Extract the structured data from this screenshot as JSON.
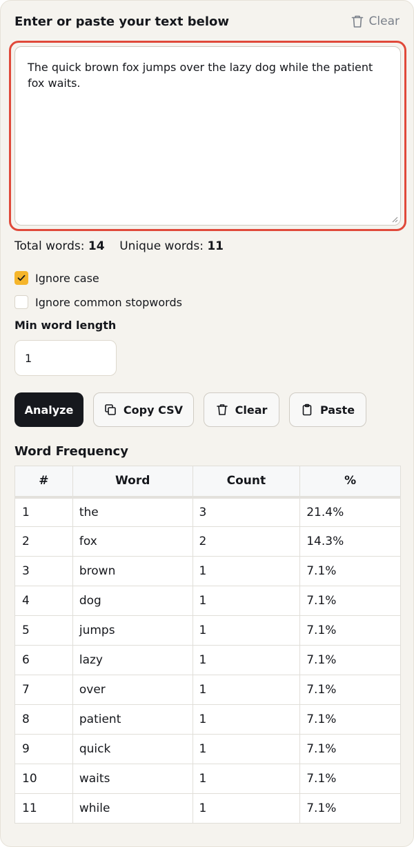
{
  "header": {
    "title": "Enter or paste your text below",
    "clear_label": "Clear"
  },
  "textarea": {
    "value": "The quick brown fox jumps over the lazy dog while the patient fox waits."
  },
  "stats": {
    "total_label": "Total words:",
    "total_value": "14",
    "unique_label": "Unique words:",
    "unique_value": "11"
  },
  "options": {
    "ignore_case": {
      "label": "Ignore case",
      "checked": true
    },
    "ignore_stopwords": {
      "label": "Ignore common stopwords",
      "checked": false
    }
  },
  "min_length": {
    "label": "Min word length",
    "value": "1"
  },
  "buttons": {
    "analyze": "Analyze",
    "copy_csv": "Copy CSV",
    "clear": "Clear",
    "paste": "Paste"
  },
  "frequency": {
    "title": "Word Frequency",
    "columns": [
      "#",
      "Word",
      "Count",
      "%"
    ],
    "rows": [
      [
        "1",
        "the",
        "3",
        "21.4%"
      ],
      [
        "2",
        "fox",
        "2",
        "14.3%"
      ],
      [
        "3",
        "brown",
        "1",
        "7.1%"
      ],
      [
        "4",
        "dog",
        "1",
        "7.1%"
      ],
      [
        "5",
        "jumps",
        "1",
        "7.1%"
      ],
      [
        "6",
        "lazy",
        "1",
        "7.1%"
      ],
      [
        "7",
        "over",
        "1",
        "7.1%"
      ],
      [
        "8",
        "patient",
        "1",
        "7.1%"
      ],
      [
        "9",
        "quick",
        "1",
        "7.1%"
      ],
      [
        "10",
        "waits",
        "1",
        "7.1%"
      ],
      [
        "11",
        "while",
        "1",
        "7.1%"
      ]
    ]
  },
  "colors": {
    "accent_checkbox": "#f5b52b",
    "focus_ring": "#e0493a",
    "primary_button": "#16181d",
    "panel_background": "#f5f3ee"
  },
  "icons": {
    "header_clear": "trash-icon",
    "copy_csv": "copy-icon",
    "clear": "trash-icon",
    "paste": "clipboard-icon",
    "checked": "check-icon"
  }
}
